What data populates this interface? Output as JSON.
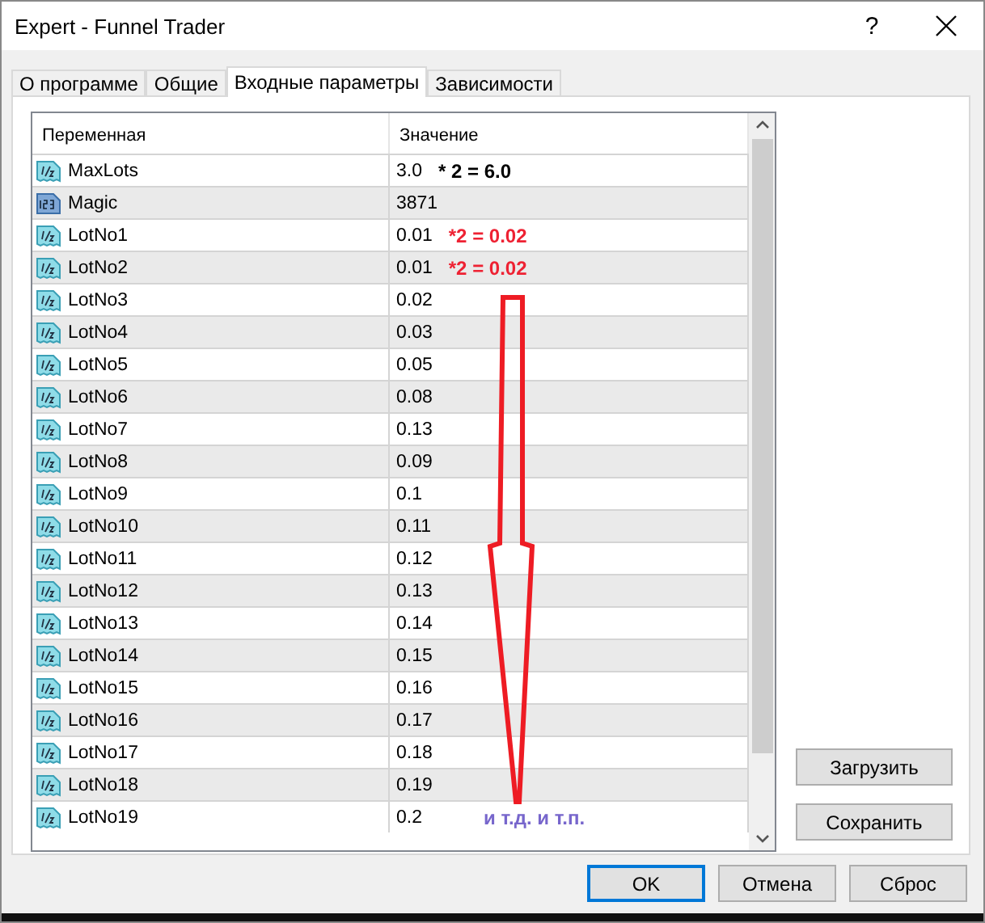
{
  "window": {
    "title": "Expert - Funnel Trader",
    "help": "?"
  },
  "tabs": [
    {
      "label": "О программе",
      "selected": false
    },
    {
      "label": "Общие",
      "selected": false
    },
    {
      "label": "Входные параметры",
      "selected": true
    },
    {
      "label": "Зависимости",
      "selected": false
    }
  ],
  "table": {
    "columns": [
      "Переменная",
      "Значение"
    ],
    "rows": [
      {
        "kind": "double",
        "name": "MaxLots",
        "value": "3.0",
        "note": {
          "text": "* 2 = 6.0",
          "color": "#000000"
        }
      },
      {
        "kind": "int",
        "name": "Magic",
        "value": "3871"
      },
      {
        "kind": "double",
        "name": "LotNo1",
        "value": "0.01",
        "note": {
          "text": "*2 = 0.02",
          "color": "#ee2233"
        }
      },
      {
        "kind": "double",
        "name": "LotNo2",
        "value": "0.01",
        "note": {
          "text": "*2 = 0.02",
          "color": "#ee2233"
        }
      },
      {
        "kind": "double",
        "name": "LotNo3",
        "value": "0.02"
      },
      {
        "kind": "double",
        "name": "LotNo4",
        "value": "0.03"
      },
      {
        "kind": "double",
        "name": "LotNo5",
        "value": "0.05"
      },
      {
        "kind": "double",
        "name": "LotNo6",
        "value": "0.08"
      },
      {
        "kind": "double",
        "name": "LotNo7",
        "value": "0.13"
      },
      {
        "kind": "double",
        "name": "LotNo8",
        "value": "0.09"
      },
      {
        "kind": "double",
        "name": "LotNo9",
        "value": "0.1"
      },
      {
        "kind": "double",
        "name": "LotNo10",
        "value": "0.11"
      },
      {
        "kind": "double",
        "name": "LotNo11",
        "value": "0.12"
      },
      {
        "kind": "double",
        "name": "LotNo12",
        "value": "0.13"
      },
      {
        "kind": "double",
        "name": "LotNo13",
        "value": "0.14"
      },
      {
        "kind": "double",
        "name": "LotNo14",
        "value": "0.15"
      },
      {
        "kind": "double",
        "name": "LotNo15",
        "value": "0.16"
      },
      {
        "kind": "double",
        "name": "LotNo16",
        "value": "0.17"
      },
      {
        "kind": "double",
        "name": "LotNo17",
        "value": "0.18"
      },
      {
        "kind": "double",
        "name": "LotNo18",
        "value": "0.19"
      },
      {
        "kind": "double",
        "name": "LotNo19",
        "value": "0.2",
        "note": {
          "text": "и т.д. и т.п.",
          "color": "#7766cc"
        }
      }
    ]
  },
  "side_buttons": [
    "Загрузить",
    "Сохранить"
  ],
  "buttons": [
    {
      "label": "OK",
      "default": true
    },
    {
      "label": "Отмена",
      "default": false
    },
    {
      "label": "Сброс",
      "default": false
    }
  ]
}
